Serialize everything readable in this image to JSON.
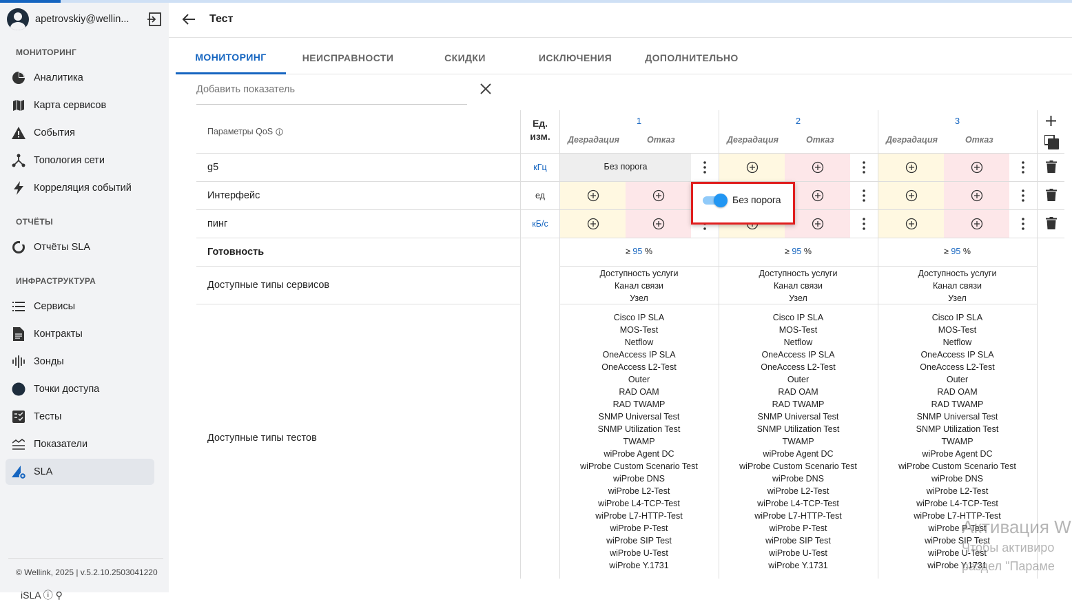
{
  "user": {
    "name": "apetrovskiy@wellin..."
  },
  "sidebar": {
    "sections": {
      "monitoring": "МОНИТОРИНГ",
      "reports": "ОТЧЁТЫ",
      "infra": "ИНФРАСТРУКТУРА"
    },
    "items": [
      {
        "label": "Аналитика",
        "icon": "pie-chart-icon"
      },
      {
        "label": "Карта сервисов",
        "icon": "map-icon"
      },
      {
        "label": "События",
        "icon": "warning-icon"
      },
      {
        "label": "Топология сети",
        "icon": "topology-icon"
      },
      {
        "label": "Корреляция событий",
        "icon": "lightning-icon"
      },
      {
        "label": "Отчёты SLA",
        "icon": "report-circle-icon"
      },
      {
        "label": "Сервисы",
        "icon": "list-icon"
      },
      {
        "label": "Контракты",
        "icon": "document-icon"
      },
      {
        "label": "Зонды",
        "icon": "probe-icon"
      },
      {
        "label": "Точки доступа",
        "icon": "access-point-icon"
      },
      {
        "label": "Тесты",
        "icon": "checklist-icon"
      },
      {
        "label": "Показатели",
        "icon": "metrics-icon"
      },
      {
        "label": "SLA",
        "icon": "sla-icon"
      }
    ],
    "footer": "© Wellink, 2025 | v.5.2.10.2503041220",
    "bottom_partial": "iSLA  ⓘ  ⚲"
  },
  "header": {
    "title": "Тест"
  },
  "tabs": [
    "МОНИТОРИНГ",
    "НЕИСПРАВНОСТИ",
    "СКИДКИ",
    "ИСКЛЮЧЕНИЯ",
    "ДОПОЛНИТЕЛЬНО"
  ],
  "add_metric": {
    "placeholder": "Добавить показатель"
  },
  "table": {
    "qos_header": "Параметры QoS",
    "unit_header": [
      "Ед.",
      "изм."
    ],
    "columns": [
      "1",
      "2",
      "3"
    ],
    "sub_degradation": "Деградация",
    "sub_failure": "Отказ",
    "rows": [
      {
        "name": "g5",
        "unit": "кГц"
      },
      {
        "name": "Интерфейс",
        "unit": "ед"
      },
      {
        "name": "пинг",
        "unit": "кБ/с"
      }
    ],
    "no_threshold": "Без порога",
    "readiness_label": "Готовность",
    "readiness_prefix": "≥",
    "readiness_value": "95",
    "readiness_unit": "%",
    "services_label": "Доступные типы сервисов",
    "services": [
      "Доступность услуги",
      "Канал связи",
      "Узел"
    ],
    "tests_label": "Доступные типы тестов",
    "tests": [
      "Cisco IP SLA",
      "MOS-Test",
      "Netflow",
      "OneAccess IP SLA",
      "OneAccess L2-Test",
      "Outer",
      "RAD OAM",
      "RAD TWAMP",
      "SNMP Universal Test",
      "SNMP Utilization Test",
      "TWAMP",
      "wiProbe Agent DC",
      "wiProbe Custom Scenario Test",
      "wiProbe DNS",
      "wiProbe L2-Test",
      "wiProbe L4-TCP-Test",
      "wiProbe L7-HTTP-Test",
      "wiProbe P-Test",
      "wiProbe SIP Test",
      "wiProbe U-Test",
      "wiProbe Y.1731"
    ]
  },
  "popup": {
    "label": "Без порога",
    "toggle_on": true
  },
  "watermark": {
    "line1": "Активация W",
    "line2": "Чтобы активиро",
    "line3": "раздел \"Параме"
  },
  "colors": {
    "accent": "#1565c0",
    "degradation_bg": "#fff8e1",
    "failure_bg": "#fde7e9",
    "highlight": "#e01e1e"
  }
}
